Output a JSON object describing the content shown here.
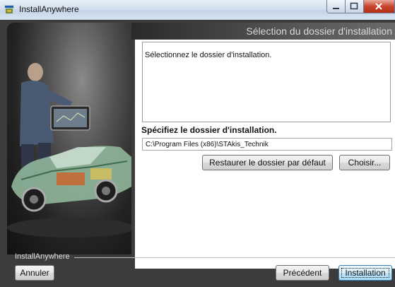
{
  "window": {
    "title": "InstallAnywhere",
    "app_icon": "installanywhere-icon",
    "controls": [
      "minimize-icon",
      "maximize-icon",
      "close-icon"
    ]
  },
  "header": {
    "title": "Sélection du dossier d'installation"
  },
  "illustration": "car-technician-illustration",
  "content": {
    "message": "Sélectionnez le dossier d'installation.",
    "spec_label": "Spécifiez le dossier d'installation.",
    "path_value": "C:\\Program Files (x86)\\STAkis_Technik",
    "restore_button": "Restaurer le dossier par défaut",
    "choose_button": "Choisir..."
  },
  "footer": {
    "brand": "InstallAnywhere",
    "cancel_button": "Annuler",
    "previous_button": "Précédent",
    "install_button": "Installation"
  },
  "colors": {
    "close_button": "#c8442c",
    "default_button_border": "#3c7fb1",
    "frame": "#3c3c3c"
  }
}
